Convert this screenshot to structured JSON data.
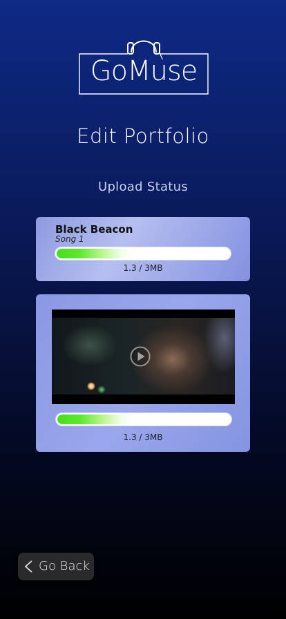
{
  "app": {
    "logo_text": "GoMuse"
  },
  "header": {
    "title": "Edit Portfolio"
  },
  "upload": {
    "section_title": "Upload Status",
    "items": [
      {
        "title": "Black Beacon",
        "subtitle": "Song 1",
        "progress": 0.43,
        "size_text": "1.3 / 3MB"
      },
      {
        "type": "video",
        "progress": 0.43,
        "size_text": "1.3 / 3MB"
      }
    ]
  },
  "footer": {
    "back_label": "Go Back"
  },
  "icons": {
    "logo": "headphones-icon",
    "play": "play-icon",
    "back": "chevron-left-icon"
  },
  "colors": {
    "progress_fill": "#46e01a",
    "card_bg": "#8e9ae0",
    "background_top": "#0e2a86"
  }
}
